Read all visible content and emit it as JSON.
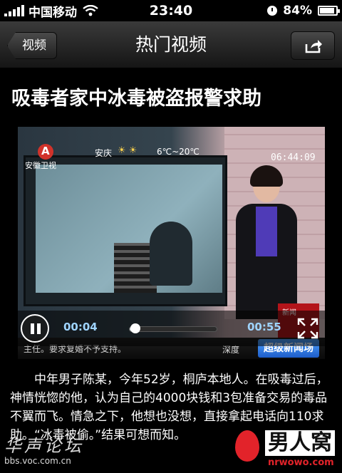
{
  "status_bar": {
    "carrier": "中国移动",
    "time": "23:40",
    "battery": "84%"
  },
  "nav": {
    "back_label": "视频",
    "title": "热门视频",
    "share_icon": "share-icon"
  },
  "article": {
    "title": "吸毒者家中冰毒被盗报警求助",
    "body": "　　中年男子陈某，今年52岁，桐庐本地人。在吸毒过后，神情恍惚的他，认为自己的4000块钱和3包准备交易的毒品不翼而飞。情急之下，他想也没想，直接拿起电话向110求助。“冰毒被偷。”结果可想而知。"
  },
  "video": {
    "channel_name": "安徽卫视",
    "city": "安庆",
    "temperature": "6℃~20℃",
    "clock_overlay": "06:44:09",
    "ticker": "主任。要求复婚不予支持。",
    "brand_prefix": "深度",
    "brand": "超级新闻场",
    "corner_label": "新闻",
    "elapsed": "00:04",
    "total": "00:55",
    "progress": 0.07
  },
  "watermarks": {
    "left_text": "华声论坛",
    "left_url": "bbs.voc.com.cn",
    "right_name": "男人窝",
    "right_domain": "nrwowo.com"
  },
  "colors": {
    "time_text": "#9fd4ff",
    "accent_red": "#e2232a"
  }
}
